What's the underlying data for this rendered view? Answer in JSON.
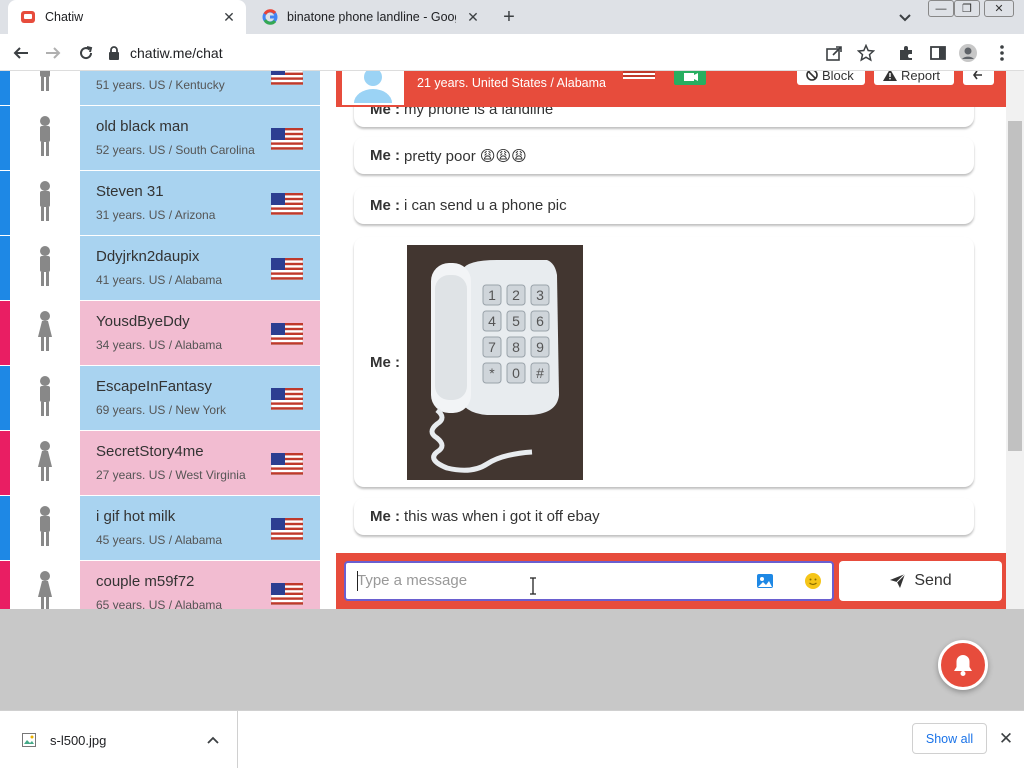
{
  "browser": {
    "tabs": [
      {
        "title": "Chatiw",
        "favicon": "chatiw-favicon-icon",
        "active": true
      },
      {
        "title": "binatone phone landline - Google",
        "favicon": "google-favicon-icon",
        "active": false
      }
    ],
    "url": "chatiw.me/chat"
  },
  "users": [
    {
      "name": "",
      "meta": "51 years. US / Kentucky",
      "gender": "male"
    },
    {
      "name": "old black man",
      "meta": "52 years. US / South Carolina",
      "gender": "male"
    },
    {
      "name": "Steven 31",
      "meta": "31 years. US / Arizona",
      "gender": "male"
    },
    {
      "name": "Ddyjrkn2daupix",
      "meta": "41 years. US / Alabama",
      "gender": "male"
    },
    {
      "name": "YousdByeDdy",
      "meta": "34 years. US / Alabama",
      "gender": "female"
    },
    {
      "name": "EscapeInFantasy",
      "meta": "69 years. US / New York",
      "gender": "male"
    },
    {
      "name": "SecretStory4me",
      "meta": "27 years. US / West Virginia",
      "gender": "female"
    },
    {
      "name": "i gif hot milk",
      "meta": "45 years. US / Alabama",
      "gender": "male"
    },
    {
      "name": "couple m59f72",
      "meta": "65 years. US / Alabama",
      "gender": "female"
    }
  ],
  "chat": {
    "partner_info": "21 years. United States / Alabama",
    "block_label": "Block",
    "report_label": "Report",
    "me_label": "Me :",
    "messages": [
      {
        "text": "my phone is a landline"
      },
      {
        "text": "pretty poor 😩😩😩"
      },
      {
        "text": "i can send u a phone pic"
      },
      {
        "text": "",
        "image": "photo of a white landline phone"
      },
      {
        "text": "this was when i got it off ebay"
      }
    ],
    "input_placeholder": "Type a message",
    "send_label": "Send"
  },
  "downloads": {
    "file_name": "s-l500.jpg",
    "show_all_label": "Show all"
  },
  "colors": {
    "chat_red": "#e74c3c",
    "male_bg": "#a9d3f0",
    "female_bg": "#f2bcd1",
    "male_stripe": "#1e88e5",
    "female_stripe": "#e91e63"
  }
}
